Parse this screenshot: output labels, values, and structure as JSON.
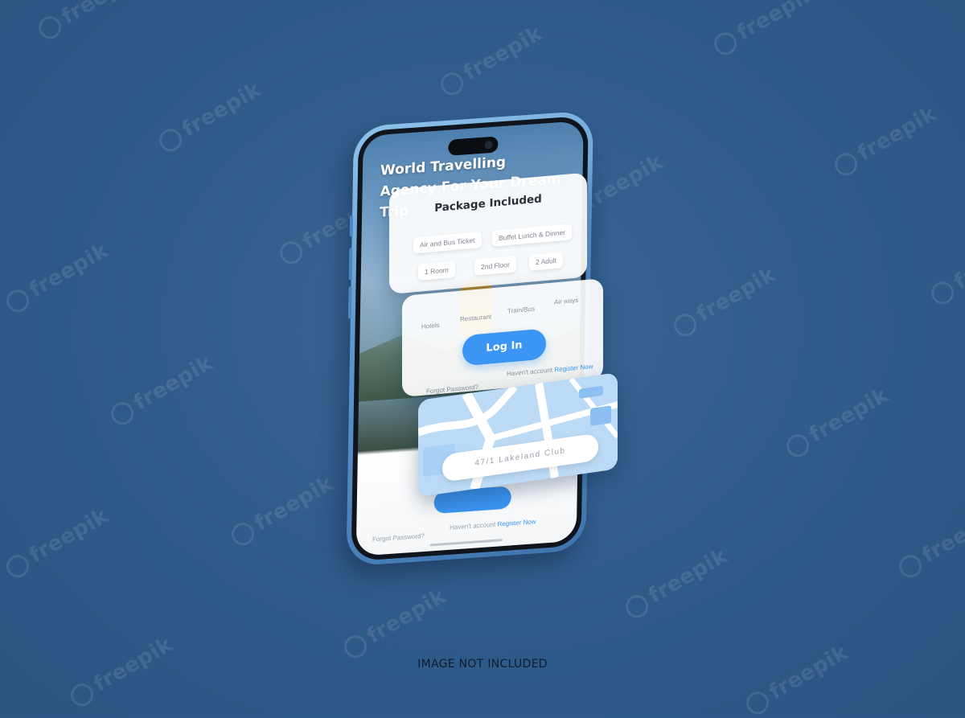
{
  "watermark": {
    "text": "freepik"
  },
  "phone": {
    "hero_title": "World Travelling Agency For Your Dream Trip",
    "screen_forgot": "Forgot Password?",
    "screen_havent": "Haven't account",
    "screen_register": "Register Now"
  },
  "package_card": {
    "title": "Package Included",
    "chips": [
      "Air and Bus Ticket",
      "Buffet Lunch & Dinner",
      "1 Room",
      "2nd Floor",
      "2 Adult"
    ]
  },
  "login_card": {
    "categories": [
      "Hotels",
      "Restaurant",
      "Train/Bus",
      "Air ways"
    ],
    "login_label": "Log In",
    "forgot": "Forgot Password?",
    "havent": "Haven't account",
    "register": "Register Now"
  },
  "map_card": {
    "address": "47/1 Lakeland Club"
  },
  "footer": {
    "note": "IMAGE NOT INCLUDED"
  },
  "colors": {
    "background": "#2f5b8b",
    "accent": "#3b95f2",
    "phone_frame": "#5e98cf",
    "map_water": "#bcdaf6"
  },
  "icons": [
    "freepik-logo-icon",
    "camera-icon"
  ]
}
